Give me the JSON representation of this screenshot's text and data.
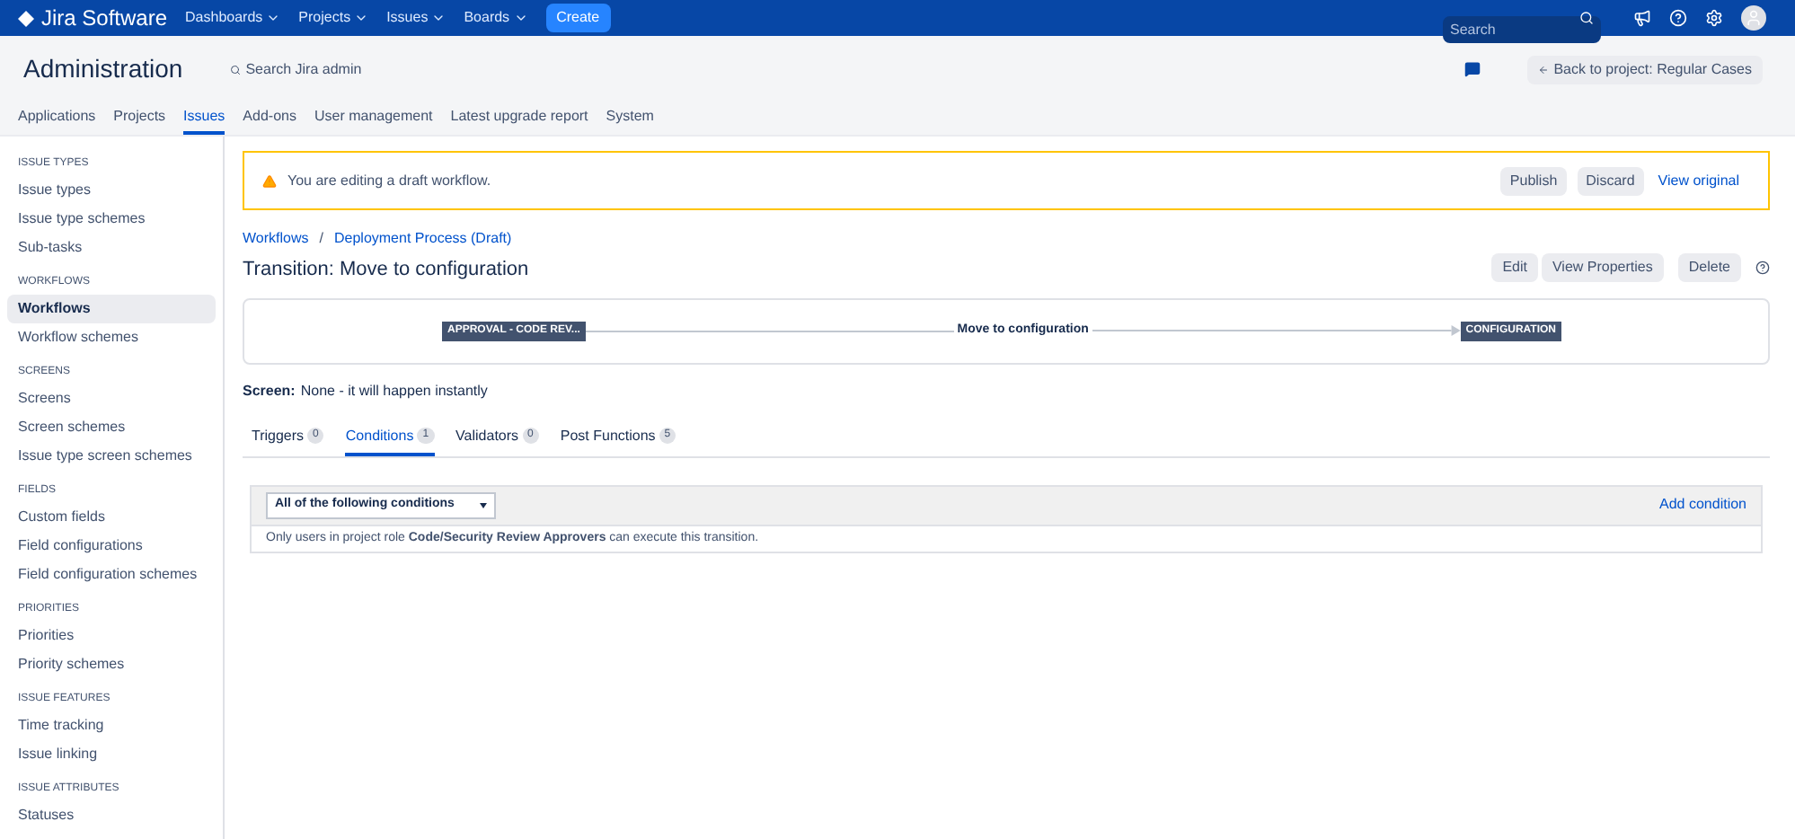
{
  "topbar": {
    "logo": "Jira Software",
    "menus": [
      {
        "label": "Dashboards"
      },
      {
        "label": "Projects"
      },
      {
        "label": "Issues"
      },
      {
        "label": "Boards"
      }
    ],
    "create": "Create",
    "search": {
      "placeholder": "Search"
    }
  },
  "header": {
    "title": "Administration",
    "search_link": "Search Jira admin",
    "back_button": "Back to project: Regular Cases"
  },
  "admin_tabs": [
    {
      "label": "Applications",
      "selected": false
    },
    {
      "label": "Projects",
      "selected": false
    },
    {
      "label": "Issues",
      "selected": true
    },
    {
      "label": "Add-ons",
      "selected": false
    },
    {
      "label": "User management",
      "selected": false
    },
    {
      "label": "Latest upgrade report",
      "selected": false
    },
    {
      "label": "System",
      "selected": false
    }
  ],
  "sidebar": [
    {
      "heading": "ISSUE TYPES",
      "items": [
        {
          "label": "Issue types",
          "selected": false
        },
        {
          "label": "Issue type schemes",
          "selected": false
        },
        {
          "label": "Sub-tasks",
          "selected": false
        }
      ]
    },
    {
      "heading": "WORKFLOWS",
      "items": [
        {
          "label": "Workflows",
          "selected": true
        },
        {
          "label": "Workflow schemes",
          "selected": false
        }
      ]
    },
    {
      "heading": "SCREENS",
      "items": [
        {
          "label": "Screens",
          "selected": false
        },
        {
          "label": "Screen schemes",
          "selected": false
        },
        {
          "label": "Issue type screen schemes",
          "selected": false
        }
      ]
    },
    {
      "heading": "FIELDS",
      "items": [
        {
          "label": "Custom fields",
          "selected": false
        },
        {
          "label": "Field configurations",
          "selected": false
        },
        {
          "label": "Field configuration schemes",
          "selected": false
        }
      ]
    },
    {
      "heading": "PRIORITIES",
      "items": [
        {
          "label": "Priorities",
          "selected": false
        },
        {
          "label": "Priority schemes",
          "selected": false
        }
      ]
    },
    {
      "heading": "ISSUE FEATURES",
      "items": [
        {
          "label": "Time tracking",
          "selected": false
        },
        {
          "label": "Issue linking",
          "selected": false
        }
      ]
    },
    {
      "heading": "ISSUE ATTRIBUTES",
      "items": [
        {
          "label": "Statuses",
          "selected": false
        }
      ]
    }
  ],
  "draft_banner": {
    "message": "You are editing a draft workflow.",
    "buttons": [
      "Publish",
      "Discard"
    ],
    "link": "View original"
  },
  "breadcrumbs": [
    "Workflows",
    "Deployment Process (Draft)"
  ],
  "breadcrumb_separator": "/",
  "page_title": "Transition: Move to configuration",
  "actions": [
    "Edit",
    "View Properties",
    "Delete"
  ],
  "diagram": {
    "from": "APPROVAL - CODE REV...",
    "transition": "Move to configuration",
    "to": "CONFIGURATION"
  },
  "screen": {
    "label": "Screen:",
    "value": "None - it will happen instantly"
  },
  "tabs": [
    {
      "label": "Triggers",
      "count": "0",
      "selected": false
    },
    {
      "label": "Conditions",
      "count": "1",
      "selected": true
    },
    {
      "label": "Validators",
      "count": "0",
      "selected": false
    },
    {
      "label": "Post Functions",
      "count": "5",
      "selected": false
    }
  ],
  "conditions": {
    "select": "All of the following conditions",
    "add": "Add condition",
    "text": "Only users in project role **Code/Security Review Approvers** can execute this transition."
  }
}
